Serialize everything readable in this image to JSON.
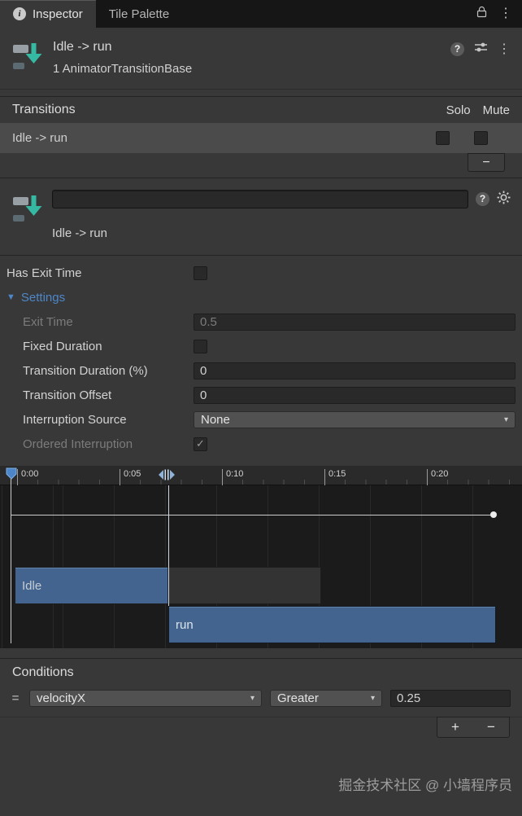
{
  "tabs": {
    "inspector": "Inspector",
    "tile_palette": "Tile Palette"
  },
  "icons": {
    "info": "i",
    "kebab": "⋮",
    "help": "?",
    "foldout_arrow": "▼",
    "dropdown_arrow": "▾",
    "handle": "="
  },
  "header": {
    "title": "Idle -> run",
    "subtitle": "1 AnimatorTransitionBase"
  },
  "transitions": {
    "title": "Transitions",
    "solo_label": "Solo",
    "mute_label": "Mute",
    "rows": [
      {
        "label": "Idle -> run",
        "solo": false,
        "mute": false
      }
    ],
    "remove_label": "−"
  },
  "detail": {
    "name_value": "",
    "label": "Idle -> run"
  },
  "props": {
    "has_exit_time": {
      "label": "Has Exit Time",
      "checked": false
    },
    "settings": {
      "label": "Settings",
      "expanded": true
    },
    "exit_time": {
      "label": "Exit Time",
      "value": "0.5",
      "disabled": true
    },
    "fixed_duration": {
      "label": "Fixed Duration",
      "checked": false
    },
    "transition_duration": {
      "label": "Transition Duration (%)",
      "value": "0"
    },
    "transition_offset": {
      "label": "Transition Offset",
      "value": "0"
    },
    "interruption_source": {
      "label": "Interruption Source",
      "value": "None"
    },
    "ordered_interruption": {
      "label": "Ordered Interruption",
      "checked": true,
      "disabled": true
    }
  },
  "timeline": {
    "ticks": [
      "0:00",
      "0:05",
      "0:10",
      "0:15",
      "0:20"
    ],
    "clips": [
      {
        "label": "Idle"
      },
      {
        "label": "run"
      }
    ]
  },
  "conditions": {
    "title": "Conditions",
    "rows": [
      {
        "parameter": "velocityX",
        "operator": "Greater",
        "value": "0.25"
      }
    ],
    "add_label": "+",
    "remove_label": "−"
  },
  "watermark": "掘金技术社区 @ 小墙程序员",
  "colors": {
    "accent_blue": "#4d87c9",
    "clip_blue": "#42648e",
    "icon_teal": "#36b9a2",
    "playhead_blue": "#4d86c8"
  }
}
